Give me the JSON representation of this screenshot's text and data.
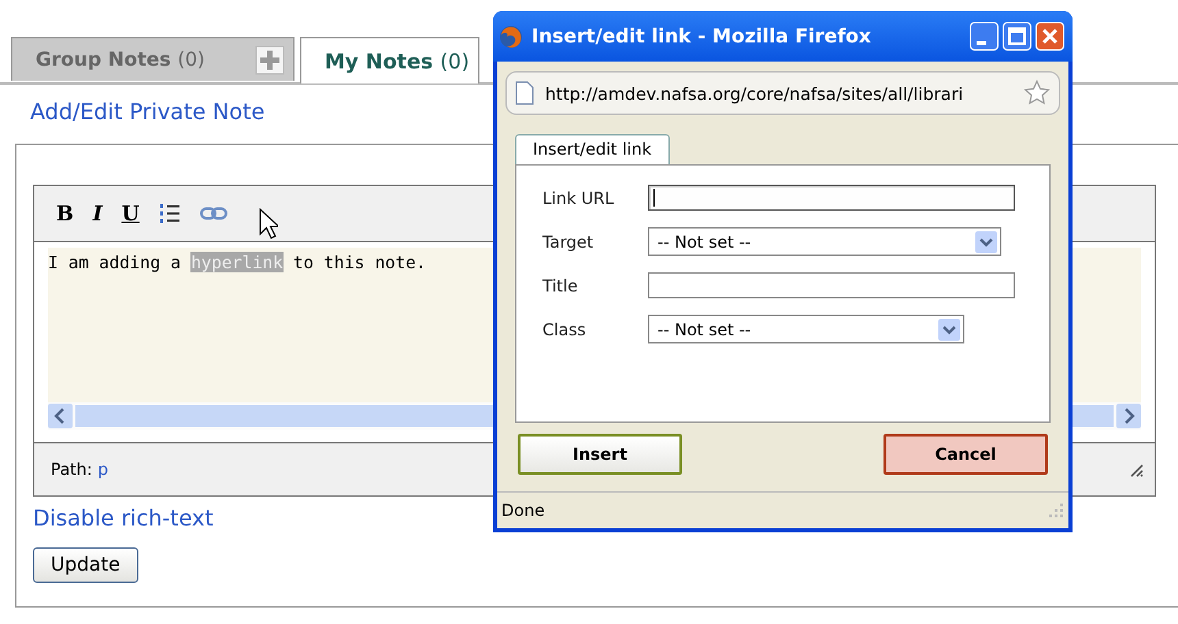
{
  "tabs": [
    {
      "label": "Group Notes",
      "count": "(0)",
      "selected": false,
      "add_button": true
    },
    {
      "label": "My Notes",
      "count": "(0)",
      "selected": true,
      "add_button": false
    }
  ],
  "heading": "Add/Edit Private Note",
  "editor": {
    "toolbar": [
      {
        "kind": "bold",
        "label": "B"
      },
      {
        "kind": "italic",
        "label": "I"
      },
      {
        "kind": "underline",
        "label": "U"
      },
      {
        "kind": "list"
      },
      {
        "kind": "link"
      }
    ],
    "content": [
      {
        "text": "I am adding a ",
        "selected": false
      },
      {
        "text": "hyperlink",
        "selected": true
      },
      {
        "text": " to this note.",
        "selected": false
      }
    ],
    "path_label": "Path:",
    "path_value": "p"
  },
  "rich_text_link": "Disable rich-text",
  "update_button": "Update",
  "dialog": {
    "title": "Insert/edit link - Mozilla Firefox",
    "address": "http://amdev.nafsa.org/core/nafsa/sites/all/librari",
    "tab": "Insert/edit link",
    "fields": [
      {
        "kind": "text",
        "label": "Link URL",
        "focused": true
      },
      {
        "kind": "select",
        "label": "Target",
        "value": "-- Not set --"
      },
      {
        "kind": "text",
        "label": "Title",
        "focused": false
      },
      {
        "kind": "select",
        "label": "Class",
        "value": "-- Not set --"
      }
    ],
    "buttons": [
      {
        "kind": "confirm",
        "label": "Insert"
      },
      {
        "kind": "cancel",
        "label": "Cancel"
      }
    ],
    "status": "Done"
  }
}
